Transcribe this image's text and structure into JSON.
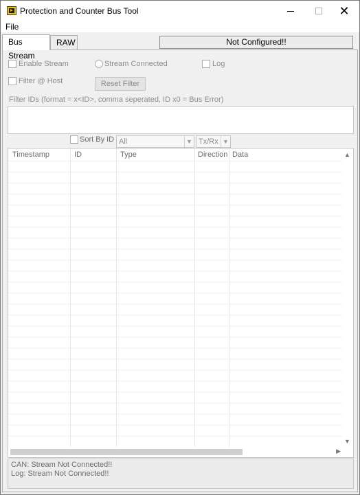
{
  "window": {
    "title": "Protection and Counter Bus Tool",
    "icons": {
      "app": "labview-vi-icon",
      "minimize": "minimize-icon",
      "maximize": "maximize-icon",
      "close": "close-icon"
    },
    "close_glyph": "✕"
  },
  "menu": {
    "items": [
      {
        "label": "File"
      }
    ]
  },
  "tabs": [
    {
      "label": "Bus Stream",
      "active": true
    },
    {
      "label": "RAW",
      "active": false
    }
  ],
  "status": {
    "config_text": "Not Configured!!"
  },
  "controls": {
    "enable_stream": {
      "label": "Enable Stream",
      "checked": false
    },
    "stream_connected": {
      "label": "Stream Connected",
      "selected": false
    },
    "log": {
      "label": "Log",
      "checked": false
    },
    "filter_at_host": {
      "label": "Filter @ Host",
      "checked": false
    },
    "reset_filter_button": "Reset Filter",
    "filter_ids_label": "Filter IDs (format = x<ID>, comma seperated, ID x0 = Bus Error)",
    "filter_ids_value": "",
    "sort_by_id": {
      "label": "Sort By ID",
      "checked": false
    },
    "type_select": {
      "value": "All"
    },
    "direction_select": {
      "value": "Tx/Rx"
    }
  },
  "table": {
    "columns": [
      "Timestamp",
      "ID",
      "Type",
      "Direction",
      "Data"
    ],
    "rows": []
  },
  "log_panel": {
    "lines": [
      "CAN: Stream Not Connected!!",
      "Log: Stream Not Connected!!"
    ]
  },
  "colors": {
    "window_bg": "#f0f0f0",
    "disabled_text": "#8c8c8c",
    "app_icon": "#f2c200"
  }
}
